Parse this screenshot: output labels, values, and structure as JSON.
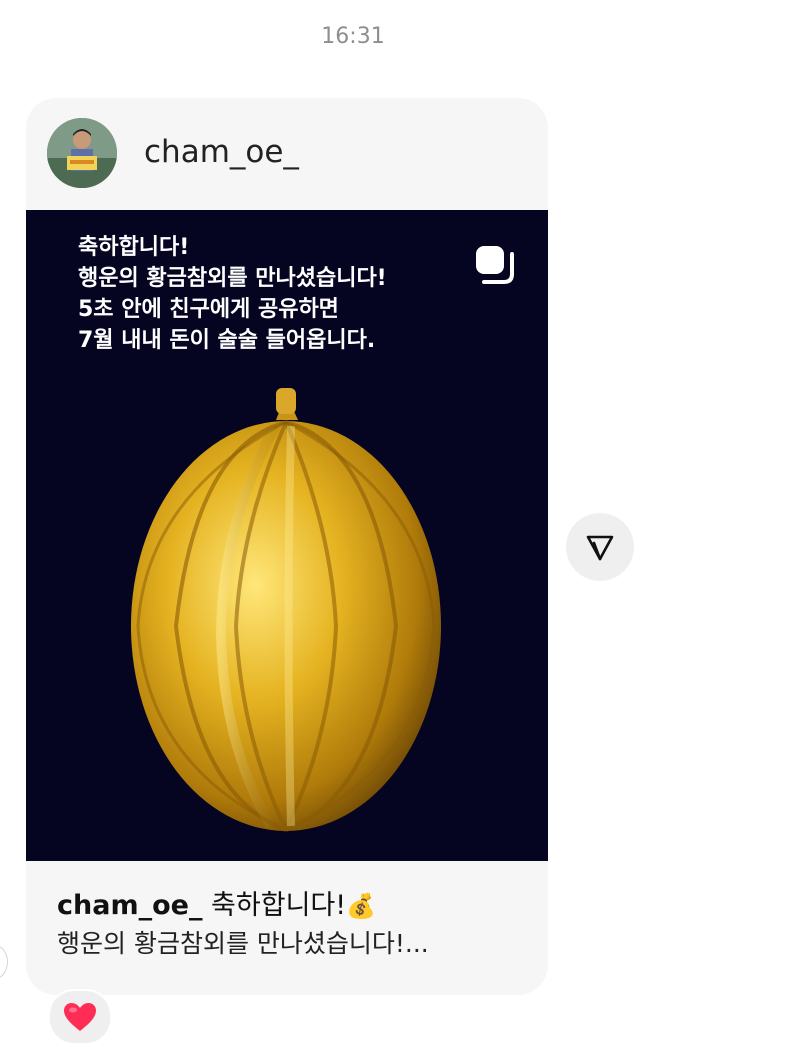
{
  "timestamp": "16:31",
  "post": {
    "username": "cham_oe_",
    "image_text": [
      "축하합니다!",
      "행운의 황금참외를 만나셨습니다!",
      "5초 안에 친구에게 공유하면",
      "7월 내내 돈이 술술 들어옵니다."
    ],
    "caption_user": "cham_oe_",
    "caption_line1": "축하합니다!",
    "caption_line2": "행운의 황금참외를 만나셨습니다!...",
    "icons": {
      "avatar": "profile-photo",
      "multi_post": "carousel-icon",
      "money": "money-bag-icon"
    }
  },
  "reaction": {
    "icon": "heart-icon",
    "color": "#ff2d55"
  },
  "share": {
    "icon": "send-icon"
  },
  "colors": {
    "card_bg": "#f5f6f5",
    "image_bg": "#050522",
    "gold": "#e5b321"
  }
}
